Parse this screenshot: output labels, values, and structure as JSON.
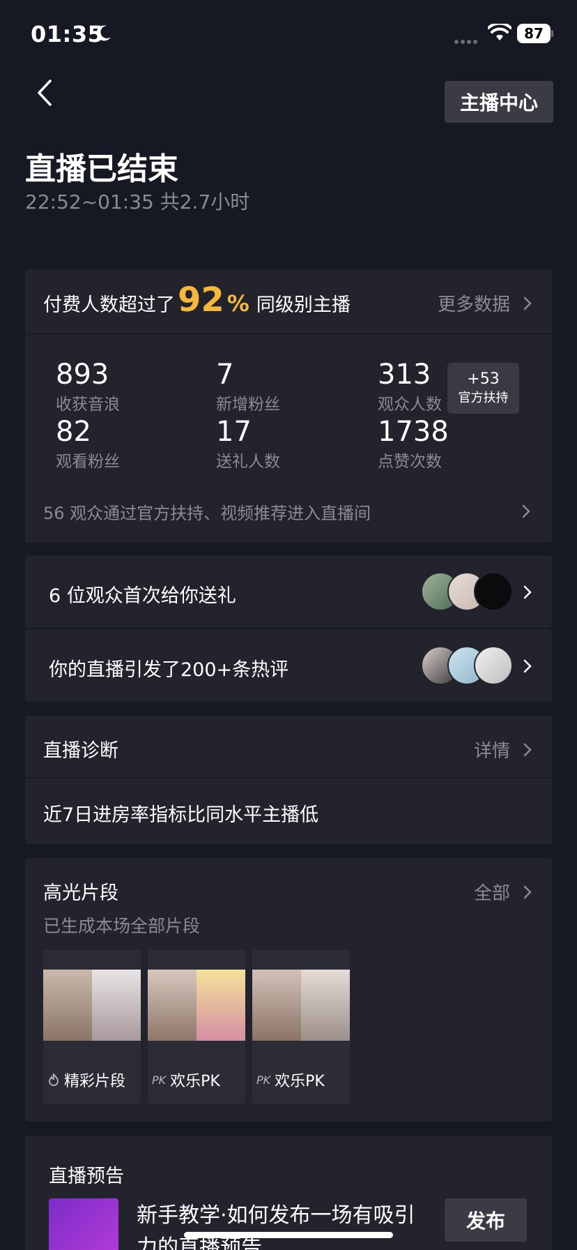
{
  "status": {
    "time": "01:35",
    "battery": "87"
  },
  "header": {
    "back_icon": "chevron-left-icon",
    "anchor_center": "主播中心"
  },
  "live": {
    "title": "直播已结束",
    "time_range": "22:52~01:35 共2.7小时"
  },
  "summary": {
    "paid_prefix": "付费人数超过了",
    "paid_percent": "92",
    "paid_percent_symbol": "%",
    "paid_suffix": "同级别主播",
    "more_data": "更多数据",
    "stats": [
      {
        "value": "893",
        "label": "收获音浪"
      },
      {
        "value": "7",
        "label": "新增粉丝"
      },
      {
        "value": "313",
        "label": "观众人数"
      },
      {
        "value": "82",
        "label": "观看粉丝"
      },
      {
        "value": "17",
        "label": "送礼人数"
      },
      {
        "value": "1738",
        "label": "点赞次数"
      }
    ],
    "boost_value": "+53",
    "boost_label": "官方扶持",
    "source_text": "56 观众通过官方扶持、视频推荐进入直播间"
  },
  "gifts_row": {
    "text": "6 位观众首次给你送礼"
  },
  "comments_row": {
    "text": "你的直播引发了200+条热评"
  },
  "diagnosis": {
    "title": "直播诊断",
    "details": "详情",
    "message": "近7日进房率指标比同水平主播低"
  },
  "highlights": {
    "title": "高光片段",
    "all": "全部",
    "subtitle": "已生成本场全部片段",
    "clips": [
      {
        "icon": "flame-icon",
        "label": "精彩片段"
      },
      {
        "icon": "PK",
        "label": "欢乐PK"
      },
      {
        "icon": "PK",
        "label": "欢乐PK"
      }
    ]
  },
  "preview": {
    "title": "直播预告",
    "headline_1": "新手教学·如何发布一场有吸引",
    "headline_2": "力的直播预告",
    "publish": "发布"
  },
  "colors": {
    "background": "#161823",
    "card": "#22232d",
    "accent": "#f5b83d",
    "muted": "#8a8b93"
  }
}
